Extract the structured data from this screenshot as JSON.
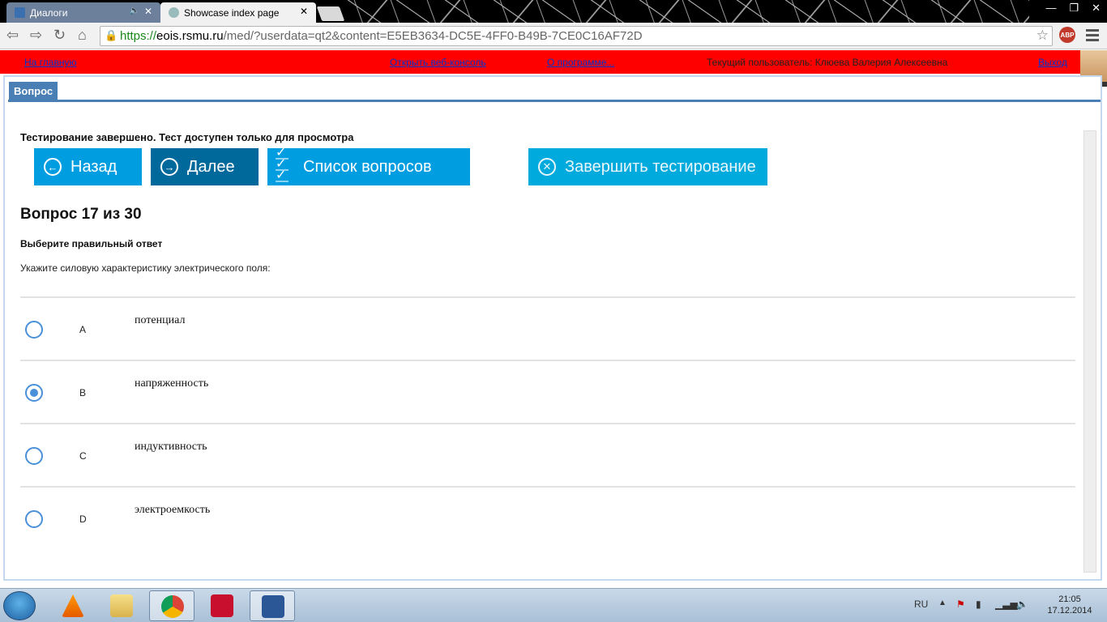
{
  "browser": {
    "tabs": [
      {
        "label": "Диалоги",
        "active": false
      },
      {
        "label": "Showcase index page",
        "active": true
      }
    ],
    "url": {
      "scheme": "https://",
      "domain": "eois.rsmu.ru",
      "path": "/med/?userdata=qt2&content=E5EB3634-DC5E-4FF0-B49B-7CE0C16AF72D"
    },
    "extension_label": "ABP"
  },
  "topbar": {
    "home_link": "На главную",
    "console_link": "Открыть веб-консоль",
    "about_link": "О программе...",
    "current_user": "Текущий пользователь: Клюева Валерия Алексеевна",
    "logout_link": "Выход"
  },
  "page": {
    "tab_label": "Вопрос",
    "notice": "Тестирование завершено. Тест доступен только для просмотра",
    "buttons": {
      "back": "Назад",
      "next": "Далее",
      "list": "Список вопросов",
      "finish": "Завершить тестирование"
    },
    "question_number": "Вопрос 17 из 30",
    "instruction": "Выберите правильный ответ",
    "question_text": "Укажите силовую характеристику электрического поля:",
    "options": [
      {
        "letter": "A",
        "text": "потенциал",
        "selected": false
      },
      {
        "letter": "B",
        "text": "напряженность",
        "selected": true
      },
      {
        "letter": "C",
        "text": "индуктивность",
        "selected": false
      },
      {
        "letter": "D",
        "text": "электроемкость",
        "selected": false
      }
    ]
  },
  "taskbar": {
    "language": "RU",
    "time": "21:05",
    "date": "17.12.2014"
  }
}
